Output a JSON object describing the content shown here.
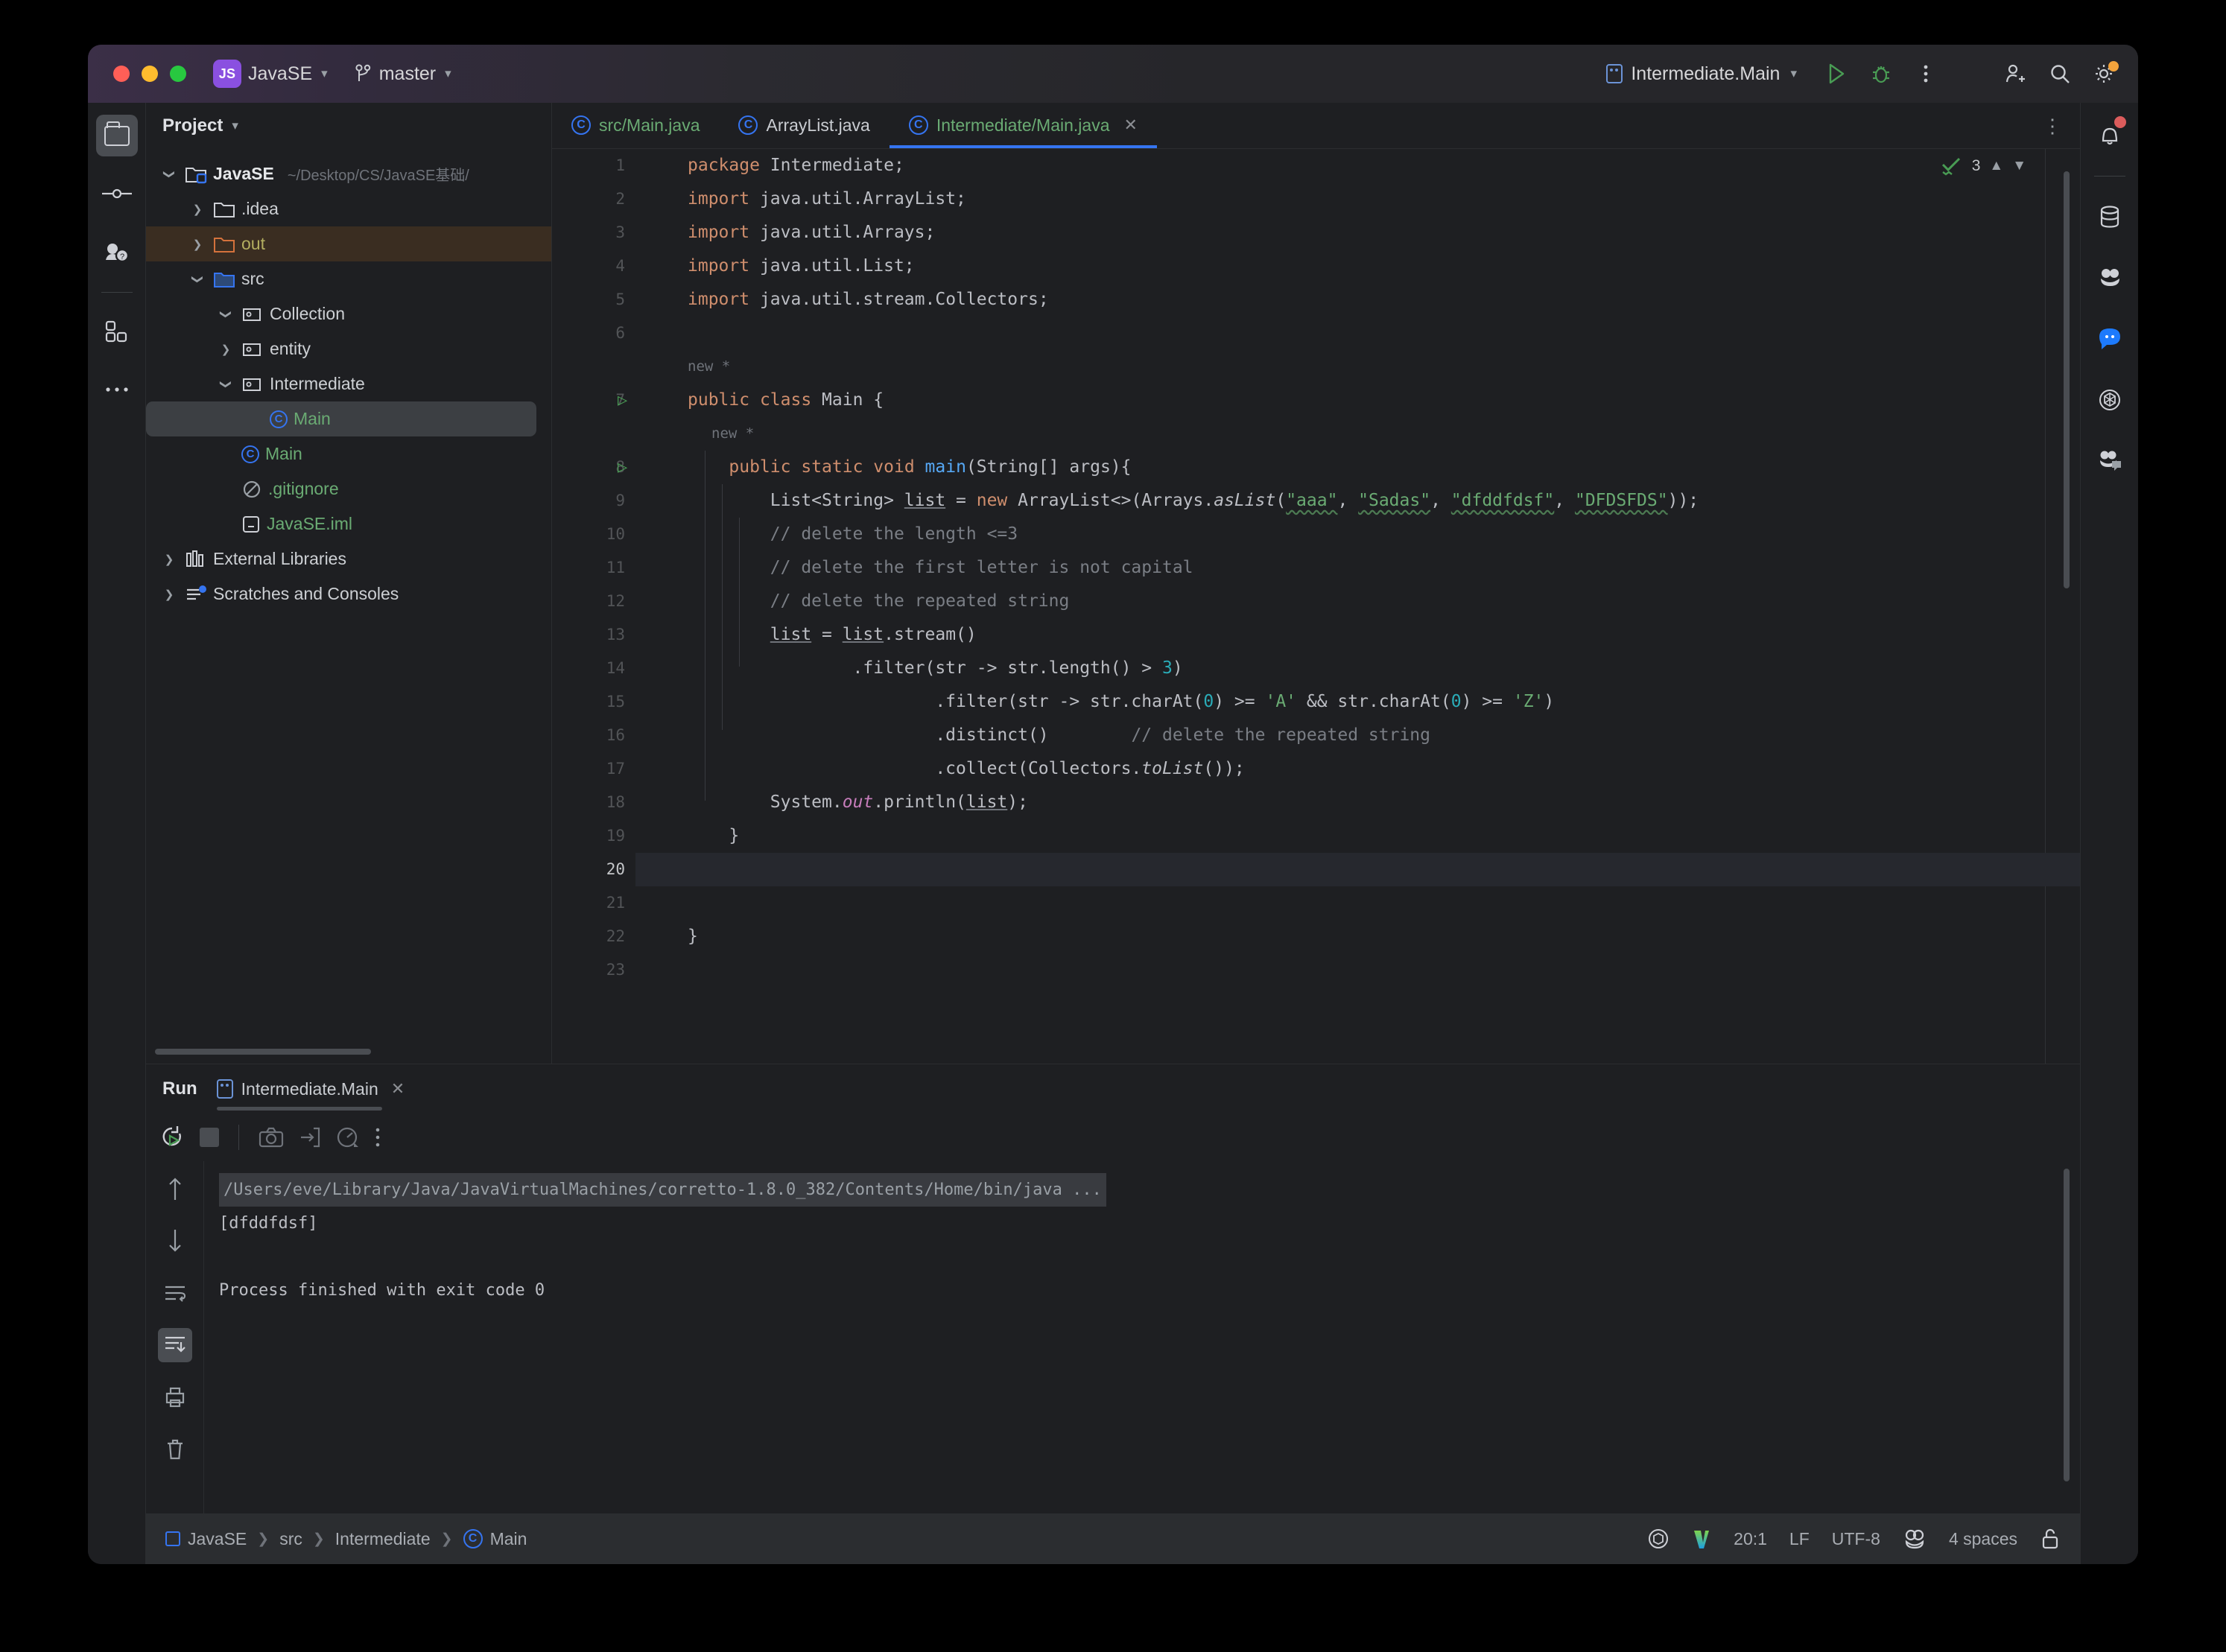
{
  "titlebar": {
    "project_badge": "JS",
    "project_name": "JavaSE",
    "branch": "master",
    "run_config": "Intermediate.Main",
    "icons": {
      "run": "run-icon",
      "debug": "debug-icon",
      "more": "more-options-icon",
      "add_user": "add-user-icon",
      "search": "search-icon",
      "settings": "settings-icon"
    }
  },
  "leftrail": {
    "items": [
      {
        "name": "project-tool-window",
        "icon": "folder-icon",
        "active": true
      },
      {
        "name": "commit-tool-window",
        "icon": "commit-icon",
        "active": false
      },
      {
        "name": "pull-requests-tool-window",
        "icon": "pull-request-icon",
        "active": false
      },
      {
        "name": "structure-tool-window",
        "icon": "structure-icon",
        "active": false
      },
      {
        "name": "more-tool-windows",
        "icon": "more-dots-icon",
        "active": false
      }
    ]
  },
  "project": {
    "header": "Project",
    "tree": [
      {
        "label": "JavaSE",
        "path": "~/Desktop/CS/JavaSE基础/",
        "indent": 0,
        "arrow": "down",
        "icon": "project-folder-icon",
        "style": "root"
      },
      {
        "label": ".idea",
        "path": "",
        "indent": 1,
        "arrow": "right",
        "icon": "folder-icon",
        "style": "plain"
      },
      {
        "label": "out",
        "path": "",
        "indent": 1,
        "arrow": "right",
        "icon": "folder-excluded-icon",
        "style": "ybrown",
        "highlight": "out"
      },
      {
        "label": "src",
        "path": "",
        "indent": 1,
        "arrow": "down",
        "icon": "source-folder-icon",
        "style": "plain"
      },
      {
        "label": "Collection",
        "path": "",
        "indent": 2,
        "arrow": "down",
        "icon": "package-icon",
        "style": "plain"
      },
      {
        "label": "entity",
        "path": "",
        "indent": 2,
        "arrow": "right",
        "icon": "package-icon",
        "style": "plain"
      },
      {
        "label": "Intermediate",
        "path": "",
        "indent": 2,
        "arrow": "down",
        "icon": "package-icon",
        "style": "plain"
      },
      {
        "label": "Main",
        "path": "",
        "indent": 3,
        "arrow": "none",
        "icon": "java-class-icon",
        "style": "green",
        "selected": true
      },
      {
        "label": "Main",
        "path": "",
        "indent": 2,
        "arrow": "none",
        "icon": "java-class-icon",
        "style": "green"
      },
      {
        "label": ".gitignore",
        "path": "",
        "indent": 2,
        "arrow": "none",
        "icon": "gitignore-icon",
        "style": "green"
      },
      {
        "label": "JavaSE.iml",
        "path": "",
        "indent": 2,
        "arrow": "none",
        "icon": "iml-file-icon",
        "style": "green"
      },
      {
        "label": "External Libraries",
        "path": "",
        "indent": 0,
        "arrow": "right",
        "icon": "libraries-icon",
        "style": "plain"
      },
      {
        "label": "Scratches and Consoles",
        "path": "",
        "indent": 0,
        "arrow": "right",
        "icon": "scratches-icon",
        "style": "plain"
      }
    ]
  },
  "editor": {
    "tabs": [
      {
        "label": "src/Main.java",
        "color": "green",
        "active": false,
        "closable": false
      },
      {
        "label": "ArrayList.java",
        "color": "white",
        "active": false,
        "closable": false
      },
      {
        "label": "Intermediate/Main.java",
        "color": "green",
        "active": true,
        "closable": true
      }
    ],
    "inspection": {
      "count": "3",
      "status": "warnings-ok"
    },
    "hint_class": "new *",
    "hint_method": "new *",
    "lines": [
      {
        "n": "1",
        "text": "package Intermediate;"
      },
      {
        "n": "2",
        "text": "import java.util.ArrayList;"
      },
      {
        "n": "3",
        "text": "import java.util.Arrays;"
      },
      {
        "n": "4",
        "text": "import java.util.List;"
      },
      {
        "n": "5",
        "text": "import java.util.stream.Collectors;"
      },
      {
        "n": "6",
        "text": ""
      },
      {
        "n": "7",
        "text": "public class Main {"
      },
      {
        "n": "8",
        "text": "    public static void main(String[] args){"
      },
      {
        "n": "9",
        "text": "        List<String> list = new ArrayList<>(Arrays.asList(\"aaa\", \"Sadas\", \"dfddfdsf\", \"DFDSFDS\"));"
      },
      {
        "n": "10",
        "text": "        // delete the length <=3"
      },
      {
        "n": "11",
        "text": "        // delete the first letter is not capital"
      },
      {
        "n": "12",
        "text": "        // delete the repeated string"
      },
      {
        "n": "13",
        "text": "        list = list.stream()"
      },
      {
        "n": "14",
        "text": "                .filter(str -> str.length() > 3)"
      },
      {
        "n": "15",
        "text": "                        .filter(str -> str.charAt(0) >= 'A' && str.charAt(0) >= 'Z')"
      },
      {
        "n": "16",
        "text": "                        .distinct()        // delete the repeated string"
      },
      {
        "n": "17",
        "text": "                        .collect(Collectors.toList());"
      },
      {
        "n": "18",
        "text": "        System.out.println(list);"
      },
      {
        "n": "19",
        "text": "    }"
      },
      {
        "n": "20",
        "text": ""
      },
      {
        "n": "21",
        "text": ""
      },
      {
        "n": "22",
        "text": "}"
      },
      {
        "n": "23",
        "text": ""
      }
    ]
  },
  "run_panel": {
    "title": "Run",
    "tab_label": "Intermediate.Main",
    "toolbar": [
      "rerun-icon",
      "stop-icon",
      "camera-icon",
      "export-icon",
      "profiler-icon",
      "more-options-icon"
    ],
    "rail": [
      {
        "name": "bottom-rail-owl",
        "icon": "assistant-owl-icon",
        "active": false
      },
      {
        "name": "build-tool-window",
        "icon": "hammer-icon",
        "active": false
      },
      {
        "name": "services-tool-window",
        "icon": "services-icon",
        "active": false
      },
      {
        "name": "dependencies-tool-window",
        "icon": "brackets-icon",
        "active": false
      },
      {
        "name": "run-tool-window",
        "icon": "run-triangle-icon",
        "active": true
      },
      {
        "name": "terminal-tool-window",
        "icon": "terminal-icon",
        "active": false
      },
      {
        "name": "problems-tool-window",
        "icon": "warning-circle-icon",
        "active": false
      },
      {
        "name": "git-tool-window",
        "icon": "branch-icon",
        "active": false
      }
    ],
    "console": [
      {
        "text": "/Users/eve/Library/Java/JavaVirtualMachines/corretto-1.8.0_382/Contents/Home/bin/java ...",
        "type": "command"
      },
      {
        "text": "[dfddfdsf]",
        "type": "output"
      },
      {
        "text": "",
        "type": "output"
      },
      {
        "text": "Process finished with exit code 0",
        "type": "output"
      }
    ],
    "console_side": [
      "up-arrow-icon",
      "down-arrow-icon",
      "soft-wrap-icon",
      "scroll-end-icon",
      "print-icon",
      "trash-icon"
    ]
  },
  "statusbar": {
    "breadcrumb": [
      "JavaSE",
      "src",
      "Intermediate",
      "Main"
    ],
    "caret": "20:1",
    "line_sep": "LF",
    "encoding": "UTF-8",
    "indent": "4 spaces",
    "right_icons": [
      "openai-icon",
      "vim-icon",
      "ai-assistant-icon",
      "lock-icon"
    ]
  },
  "rightrail": {
    "items": [
      {
        "name": "notifications",
        "icon": "bell-icon",
        "badge": true
      },
      {
        "name": "database-tool-window",
        "icon": "database-icon",
        "badge": false
      },
      {
        "name": "ai-assistant-tool-window",
        "icon": "ai-face-icon",
        "badge": false
      },
      {
        "name": "chat-tool-window",
        "icon": "chat-bubble-icon",
        "badge": false,
        "accent": "#1d7afc"
      },
      {
        "name": "openai-tool-window",
        "icon": "openai-icon",
        "badge": false
      },
      {
        "name": "ai-chat-tool-window",
        "icon": "ai-chat-icon",
        "badge": false
      }
    ]
  },
  "colors": {
    "accent": "#3574f0",
    "keyword": "#cf8e6d",
    "string": "#6aab73",
    "number": "#2aacb8",
    "comment": "#7a7e85",
    "method": "#56a8f5",
    "field": "#c77dbb",
    "background": "#1e1f22",
    "run_green": "#499c54"
  }
}
